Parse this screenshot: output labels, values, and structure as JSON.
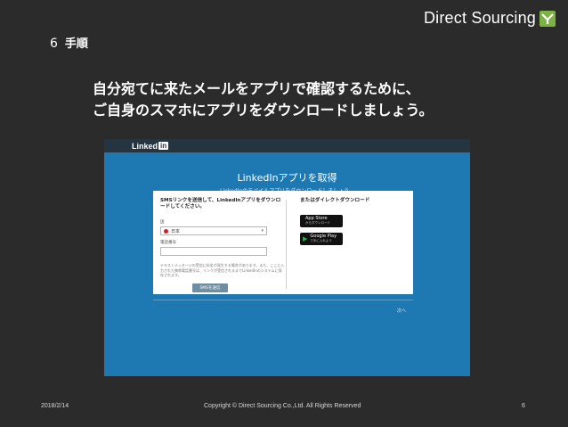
{
  "brand": {
    "name": "Direct Sourcing"
  },
  "step": {
    "number": "6",
    "title": "手順"
  },
  "headline": {
    "line1": "自分宛てに来たメールをアプリで確認するために、",
    "line2": "ご自身のスマホにアプリをダウンロードしましょう。"
  },
  "screenshot": {
    "logo_text": "Linked",
    "logo_box": "in",
    "title": "LinkedInアプリを取得",
    "subtitle": "LinkedInのモバイルアプリをダウンロードしましょう。",
    "left_heading": "SMSリンクを送信して、LinkedInアプリをダウンロードしてください。",
    "country_label": "国",
    "country_value": "日本",
    "phone_label": "電話番号",
    "fine_print": "テキストメッセージの受信に料金が発生する場合があります。また、ここに入力された携帯電話番号は、リンクが受信されるまでLinkedInのシステムに保存されます。",
    "sms_button": "SMSを送信",
    "right_heading": "またはダイレクトダウンロード",
    "app_store": {
      "name": "App Store",
      "sub": "からダウンロード"
    },
    "google_play": {
      "name": "Google Play",
      "sub": "で手に入れよう"
    },
    "next_link": "次へ"
  },
  "footer": {
    "date": "2018/2/14",
    "copyright": "Copyright © Direct Sourcing Co.,Ltd. All Rights Reserved",
    "page": "6"
  },
  "colors": {
    "background": "#2b2b2b",
    "linkedin_blue": "#1e79b3",
    "brand_green": "#7cb342"
  }
}
